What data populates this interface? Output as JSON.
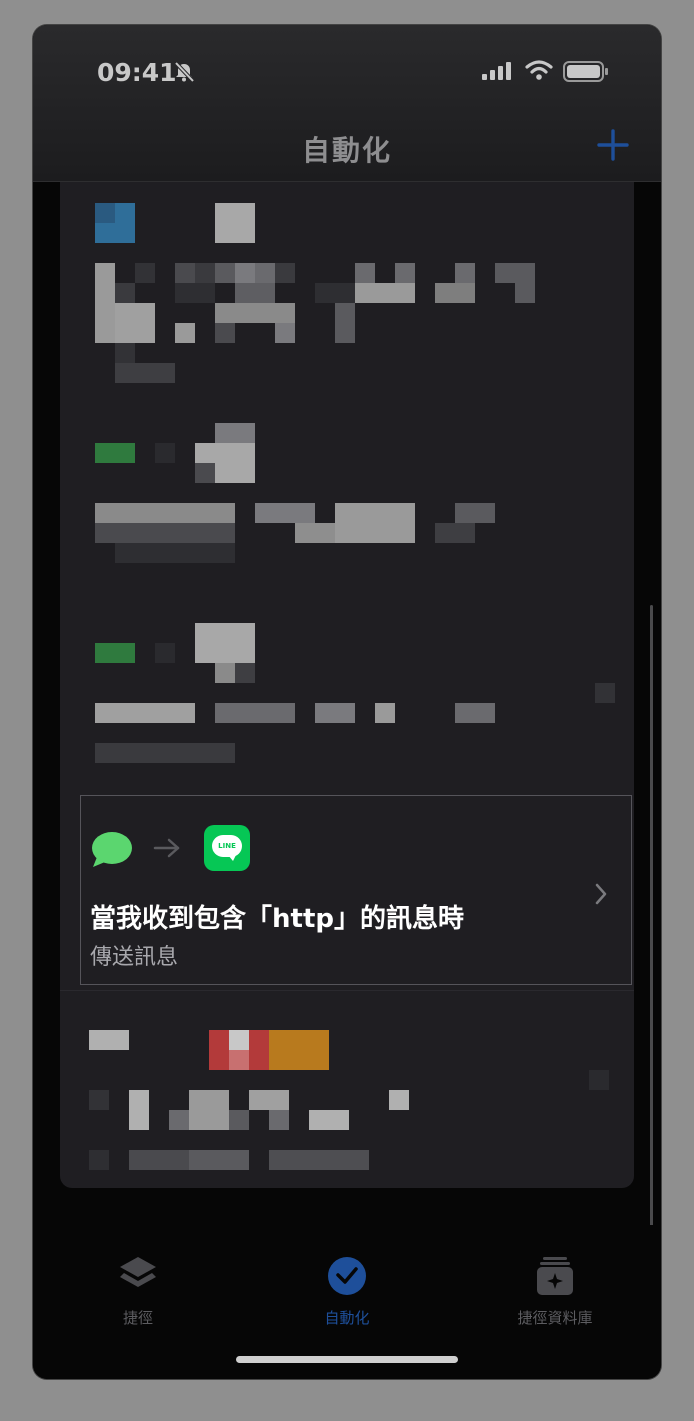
{
  "status_bar": {
    "time": "09:41"
  },
  "nav": {
    "title": "自動化"
  },
  "automation_card": {
    "title": "當我收到包含「http」的訊息時",
    "subtitle": "傳送訊息",
    "line_icon_text": "LINE"
  },
  "tabs": [
    {
      "label": "捷徑",
      "icon": "layers-icon",
      "active": false
    },
    {
      "label": "自動化",
      "icon": "clock-check-icon",
      "active": true
    },
    {
      "label": "捷徑資料庫",
      "icon": "gallery-icon",
      "active": false
    }
  ],
  "colors": {
    "accent": "#1e4f9a",
    "messages_green": "#5bd66f",
    "line_green": "#06c755"
  }
}
